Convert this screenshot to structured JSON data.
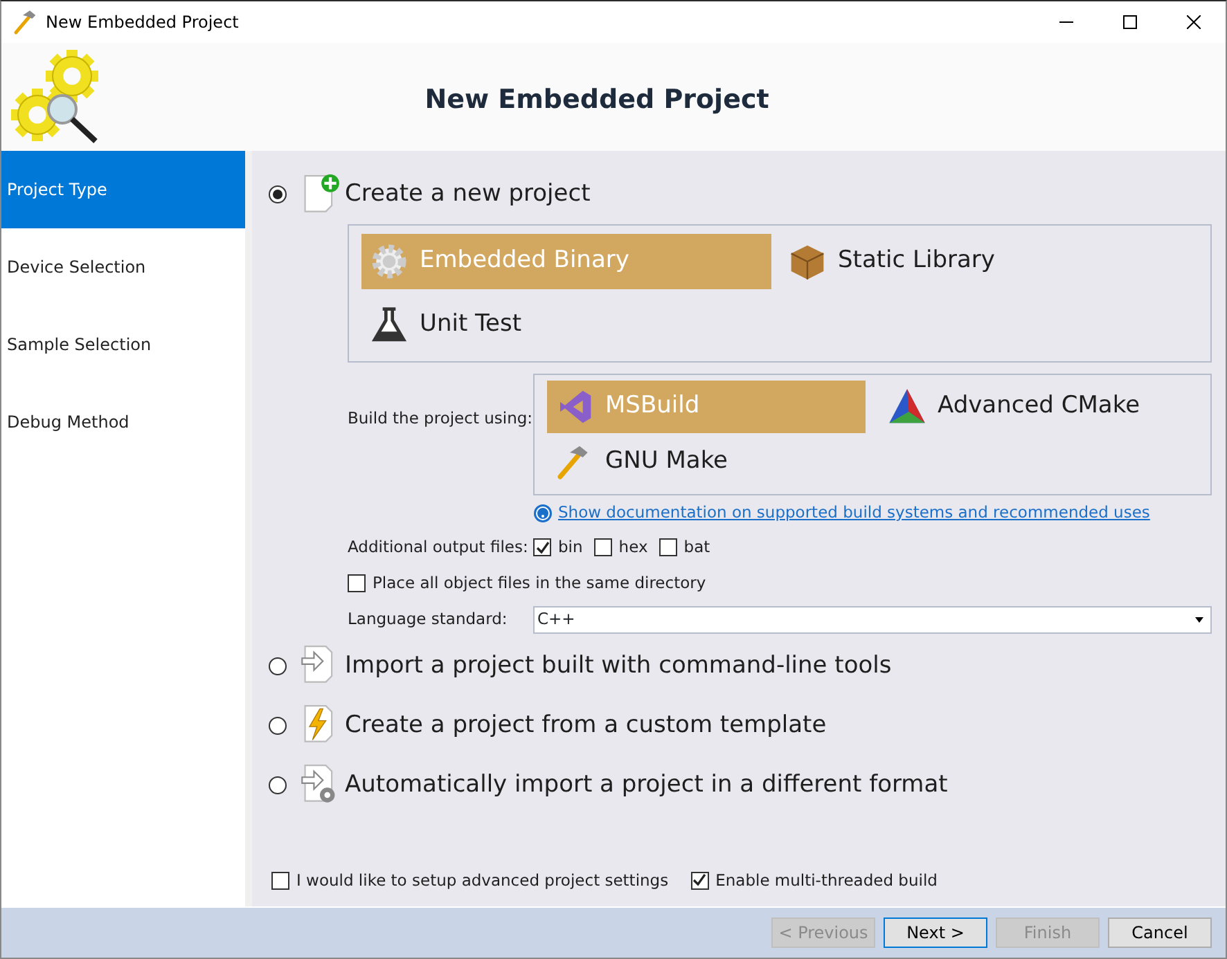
{
  "window": {
    "title": "New Embedded Project"
  },
  "header": {
    "title": "New Embedded Project"
  },
  "sidebar": {
    "items": [
      {
        "label": "Project Type",
        "selected": true
      },
      {
        "label": "Device Selection",
        "selected": false
      },
      {
        "label": "Sample Selection",
        "selected": false
      },
      {
        "label": "Debug Method",
        "selected": false
      }
    ]
  },
  "options": [
    {
      "label": "Create a new project",
      "selected": true,
      "kind": "new"
    },
    {
      "label": "Import a project built with command-line tools",
      "selected": false,
      "kind": "import"
    },
    {
      "label": "Create a project from a custom template",
      "selected": false,
      "kind": "template"
    },
    {
      "label": "Automatically import a project in a different format",
      "selected": false,
      "kind": "convert"
    }
  ],
  "project_kinds": [
    {
      "label": "Embedded Binary",
      "selected": true,
      "kind": "binary"
    },
    {
      "label": "Static Library",
      "selected": false,
      "kind": "library"
    },
    {
      "label": "Unit Test",
      "selected": false,
      "kind": "test"
    }
  ],
  "build": {
    "label": "Build the project using:",
    "items": [
      {
        "label": "MSBuild",
        "selected": true,
        "kind": "msbuild"
      },
      {
        "label": "Advanced CMake",
        "selected": false,
        "kind": "cmake"
      },
      {
        "label": "GNU Make",
        "selected": false,
        "kind": "make"
      }
    ]
  },
  "doc_link": "Show documentation on supported build systems and recommended uses",
  "output_files": {
    "label": "Additional output files:",
    "items": [
      {
        "label": "bin",
        "checked": true
      },
      {
        "label": "hex",
        "checked": false
      },
      {
        "label": "bat",
        "checked": false
      }
    ]
  },
  "same_dir": {
    "label": "Place all object files in the same directory",
    "checked": false
  },
  "language": {
    "label": "Language standard:",
    "value": "C++"
  },
  "bottom_checks": [
    {
      "label": "I would like to setup advanced project settings",
      "checked": false
    },
    {
      "label": "Enable multi-threaded build",
      "checked": true
    }
  ],
  "buttons": [
    {
      "label": "< Previous",
      "disabled": true,
      "default": false
    },
    {
      "label": "Next >",
      "disabled": false,
      "default": true
    },
    {
      "label": "Finish",
      "disabled": true,
      "default": false
    },
    {
      "label": "Cancel",
      "disabled": false,
      "default": false
    }
  ]
}
